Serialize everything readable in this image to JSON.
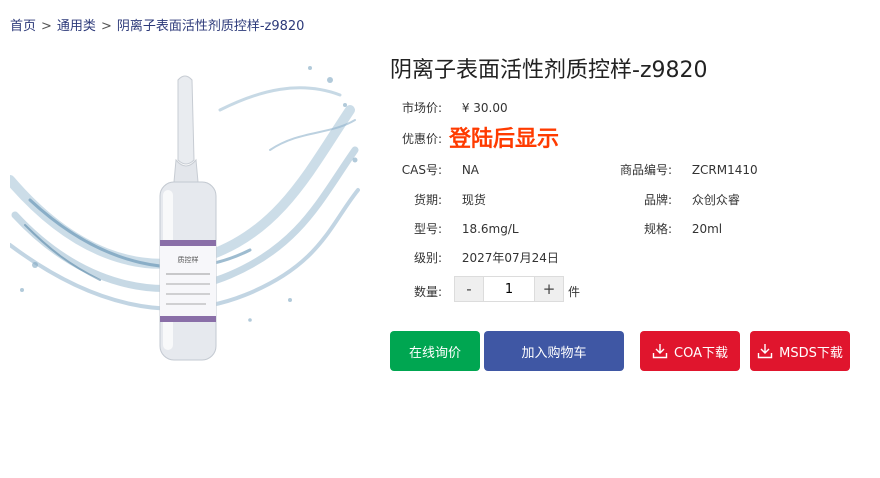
{
  "breadcrumb": {
    "home": "首页",
    "separator": ">",
    "category": "通用类",
    "current": "阴离子表面活性剂质控样-z9820"
  },
  "product": {
    "title": "阴离子表面活性剂质控样-z9820",
    "image": {
      "label_text": "质控样"
    },
    "market_price_label": "市场价:",
    "market_price": "¥ 30.00",
    "promo_label": "优惠价:",
    "promo_text": "登陆后显示",
    "cas_label": "CAS号:",
    "cas": "NA",
    "sku_label": "商品编号:",
    "sku": "ZCRM1410",
    "stock_label": "货期:",
    "stock": "现货",
    "brand_label": "品牌:",
    "brand": "众创众睿",
    "model_label": "型号:",
    "model": "18.6mg/L",
    "spec_label": "规格:",
    "spec": "20ml",
    "grade_label": "级别:",
    "grade": "2027年07月24日",
    "qty_label": "数量:",
    "qty_minus": "-",
    "qty_value": "1",
    "qty_plus": "+",
    "qty_unit": "件"
  },
  "actions": {
    "inquiry": "在线询价",
    "add_cart": "加入购物车",
    "coa": "COA下载",
    "msds": "MSDS下载"
  },
  "colors": {
    "breadcrumb": "#2d3a7a",
    "promo": "#ff3b00",
    "inquiry_bg": "#00a651",
    "cart_bg": "#3f57a4",
    "download_bg": "#e0152d"
  },
  "icons": {
    "download": "download-icon"
  }
}
